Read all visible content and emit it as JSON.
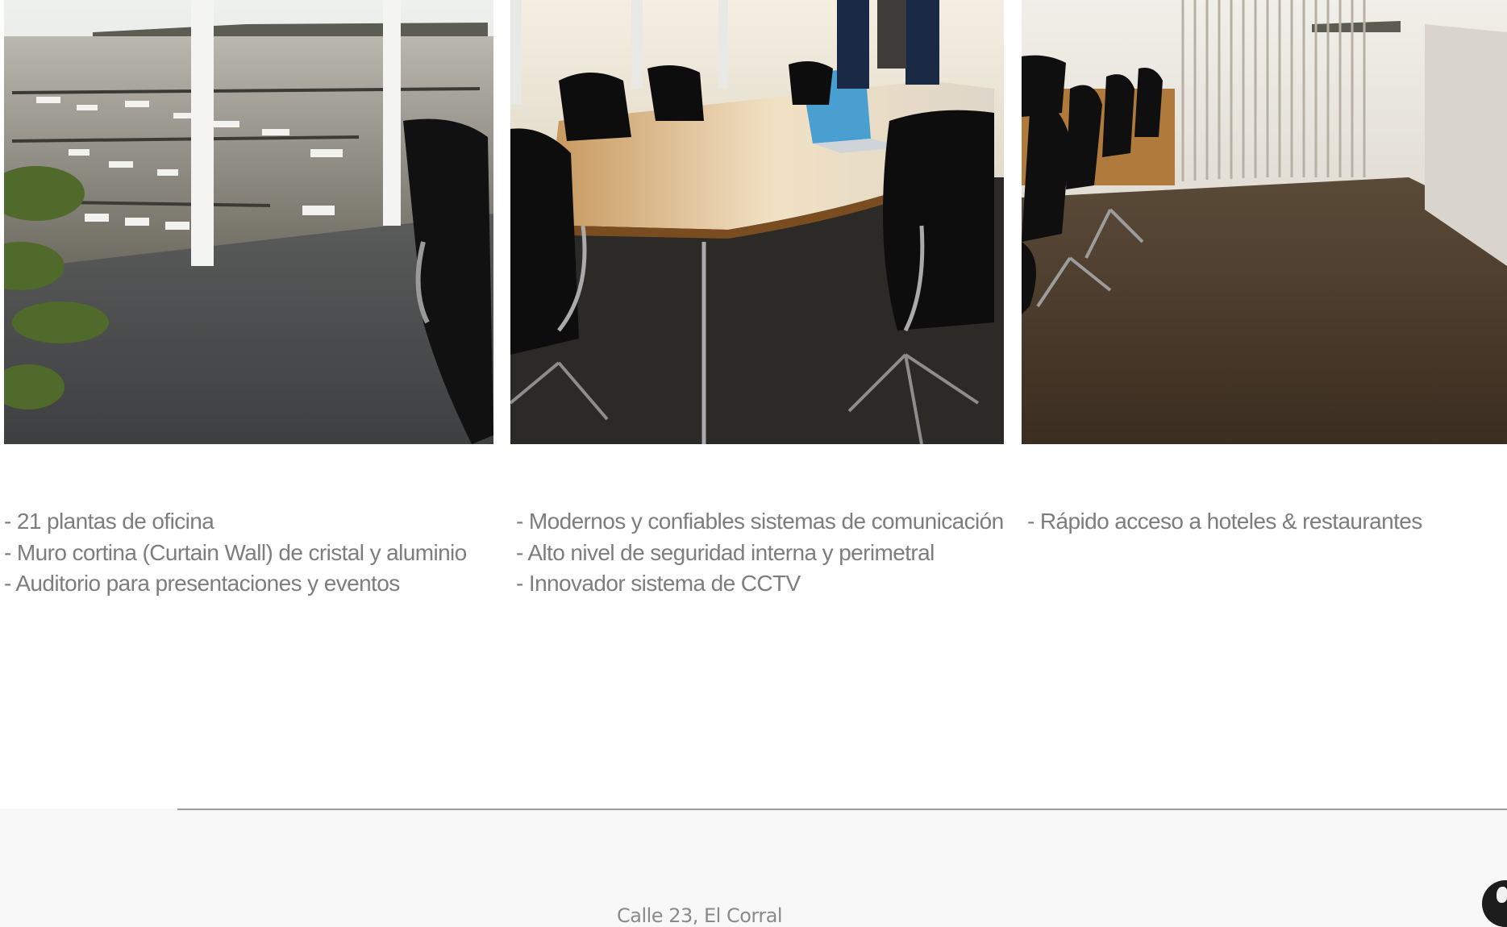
{
  "photos": [
    {
      "alt": "Vista de oficina con ventanal al puerto"
    },
    {
      "alt": "Sala de reuniones con mesa de madera"
    },
    {
      "alt": "Oficina con sillas y mamparas de vidrio"
    }
  ],
  "features": {
    "col1": [
      "21 plantas de oficina",
      "Muro cortina (Curtain Wall) de cristal y aluminio",
      "Auditorio para presentaciones y eventos"
    ],
    "col2": [
      "Modernos y confiables sistemas de comunicación",
      "Alto nivel de seguridad interna y perimetral",
      "Innovador sistema de CCTV"
    ],
    "col3": [
      "Rápido acceso a hoteles & restaurantes"
    ]
  },
  "footer": {
    "address": "Calle 23, El Corral"
  },
  "colors": {
    "text": "#7d7d7d",
    "footer_bg": "#f7f8f7",
    "rule": "#9a9c9c"
  }
}
